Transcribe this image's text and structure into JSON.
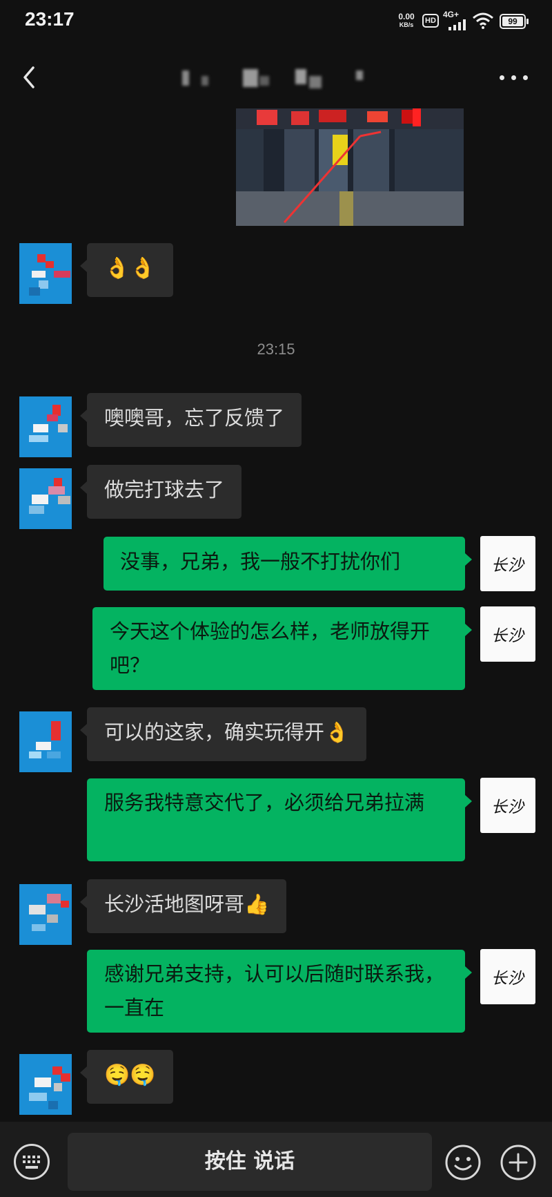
{
  "status_bar": {
    "time": "23:17",
    "net_speed": "0.00",
    "net_unit": "KB/s",
    "hd_label": "HD",
    "signal_label": "4G+",
    "battery": "99"
  },
  "header": {
    "title": "",
    "back_icon": "chevron-left-icon",
    "more_icon": "more-horizontal-icon"
  },
  "chat": {
    "timestamp": "23:15",
    "messages": [
      {
        "side": "in",
        "text": "👌👌"
      },
      {
        "side": "in",
        "text": "噢噢哥，忘了反馈了"
      },
      {
        "side": "in",
        "text": "做完打球去了"
      },
      {
        "side": "out",
        "text": "没事，兄弟，我一般不打扰你们"
      },
      {
        "side": "out",
        "text": "今天这个体验的怎么样，老师放得开吧？"
      },
      {
        "side": "in",
        "text": "可以的这家，确实玩得开👌"
      },
      {
        "side": "out",
        "text": "服务我特意交代了，必须给兄弟拉满"
      },
      {
        "side": "in",
        "text": "长沙活地图呀哥👍"
      },
      {
        "side": "out",
        "text": "感谢兄弟支持，认可以后随时联系我，一直在"
      },
      {
        "side": "in",
        "text": "🤤🤤"
      }
    ],
    "self_avatar_label": "长沙"
  },
  "input_bar": {
    "talk_label": "按住 说话",
    "keyboard_icon": "keyboard-icon",
    "emoji_icon": "smiley-icon",
    "plus_icon": "plus-circle-icon"
  },
  "colors": {
    "background": "#111111",
    "incoming_bubble": "#2c2c2c",
    "outgoing_bubble": "#04b361",
    "avatar_blue": "#1b8fd6"
  }
}
